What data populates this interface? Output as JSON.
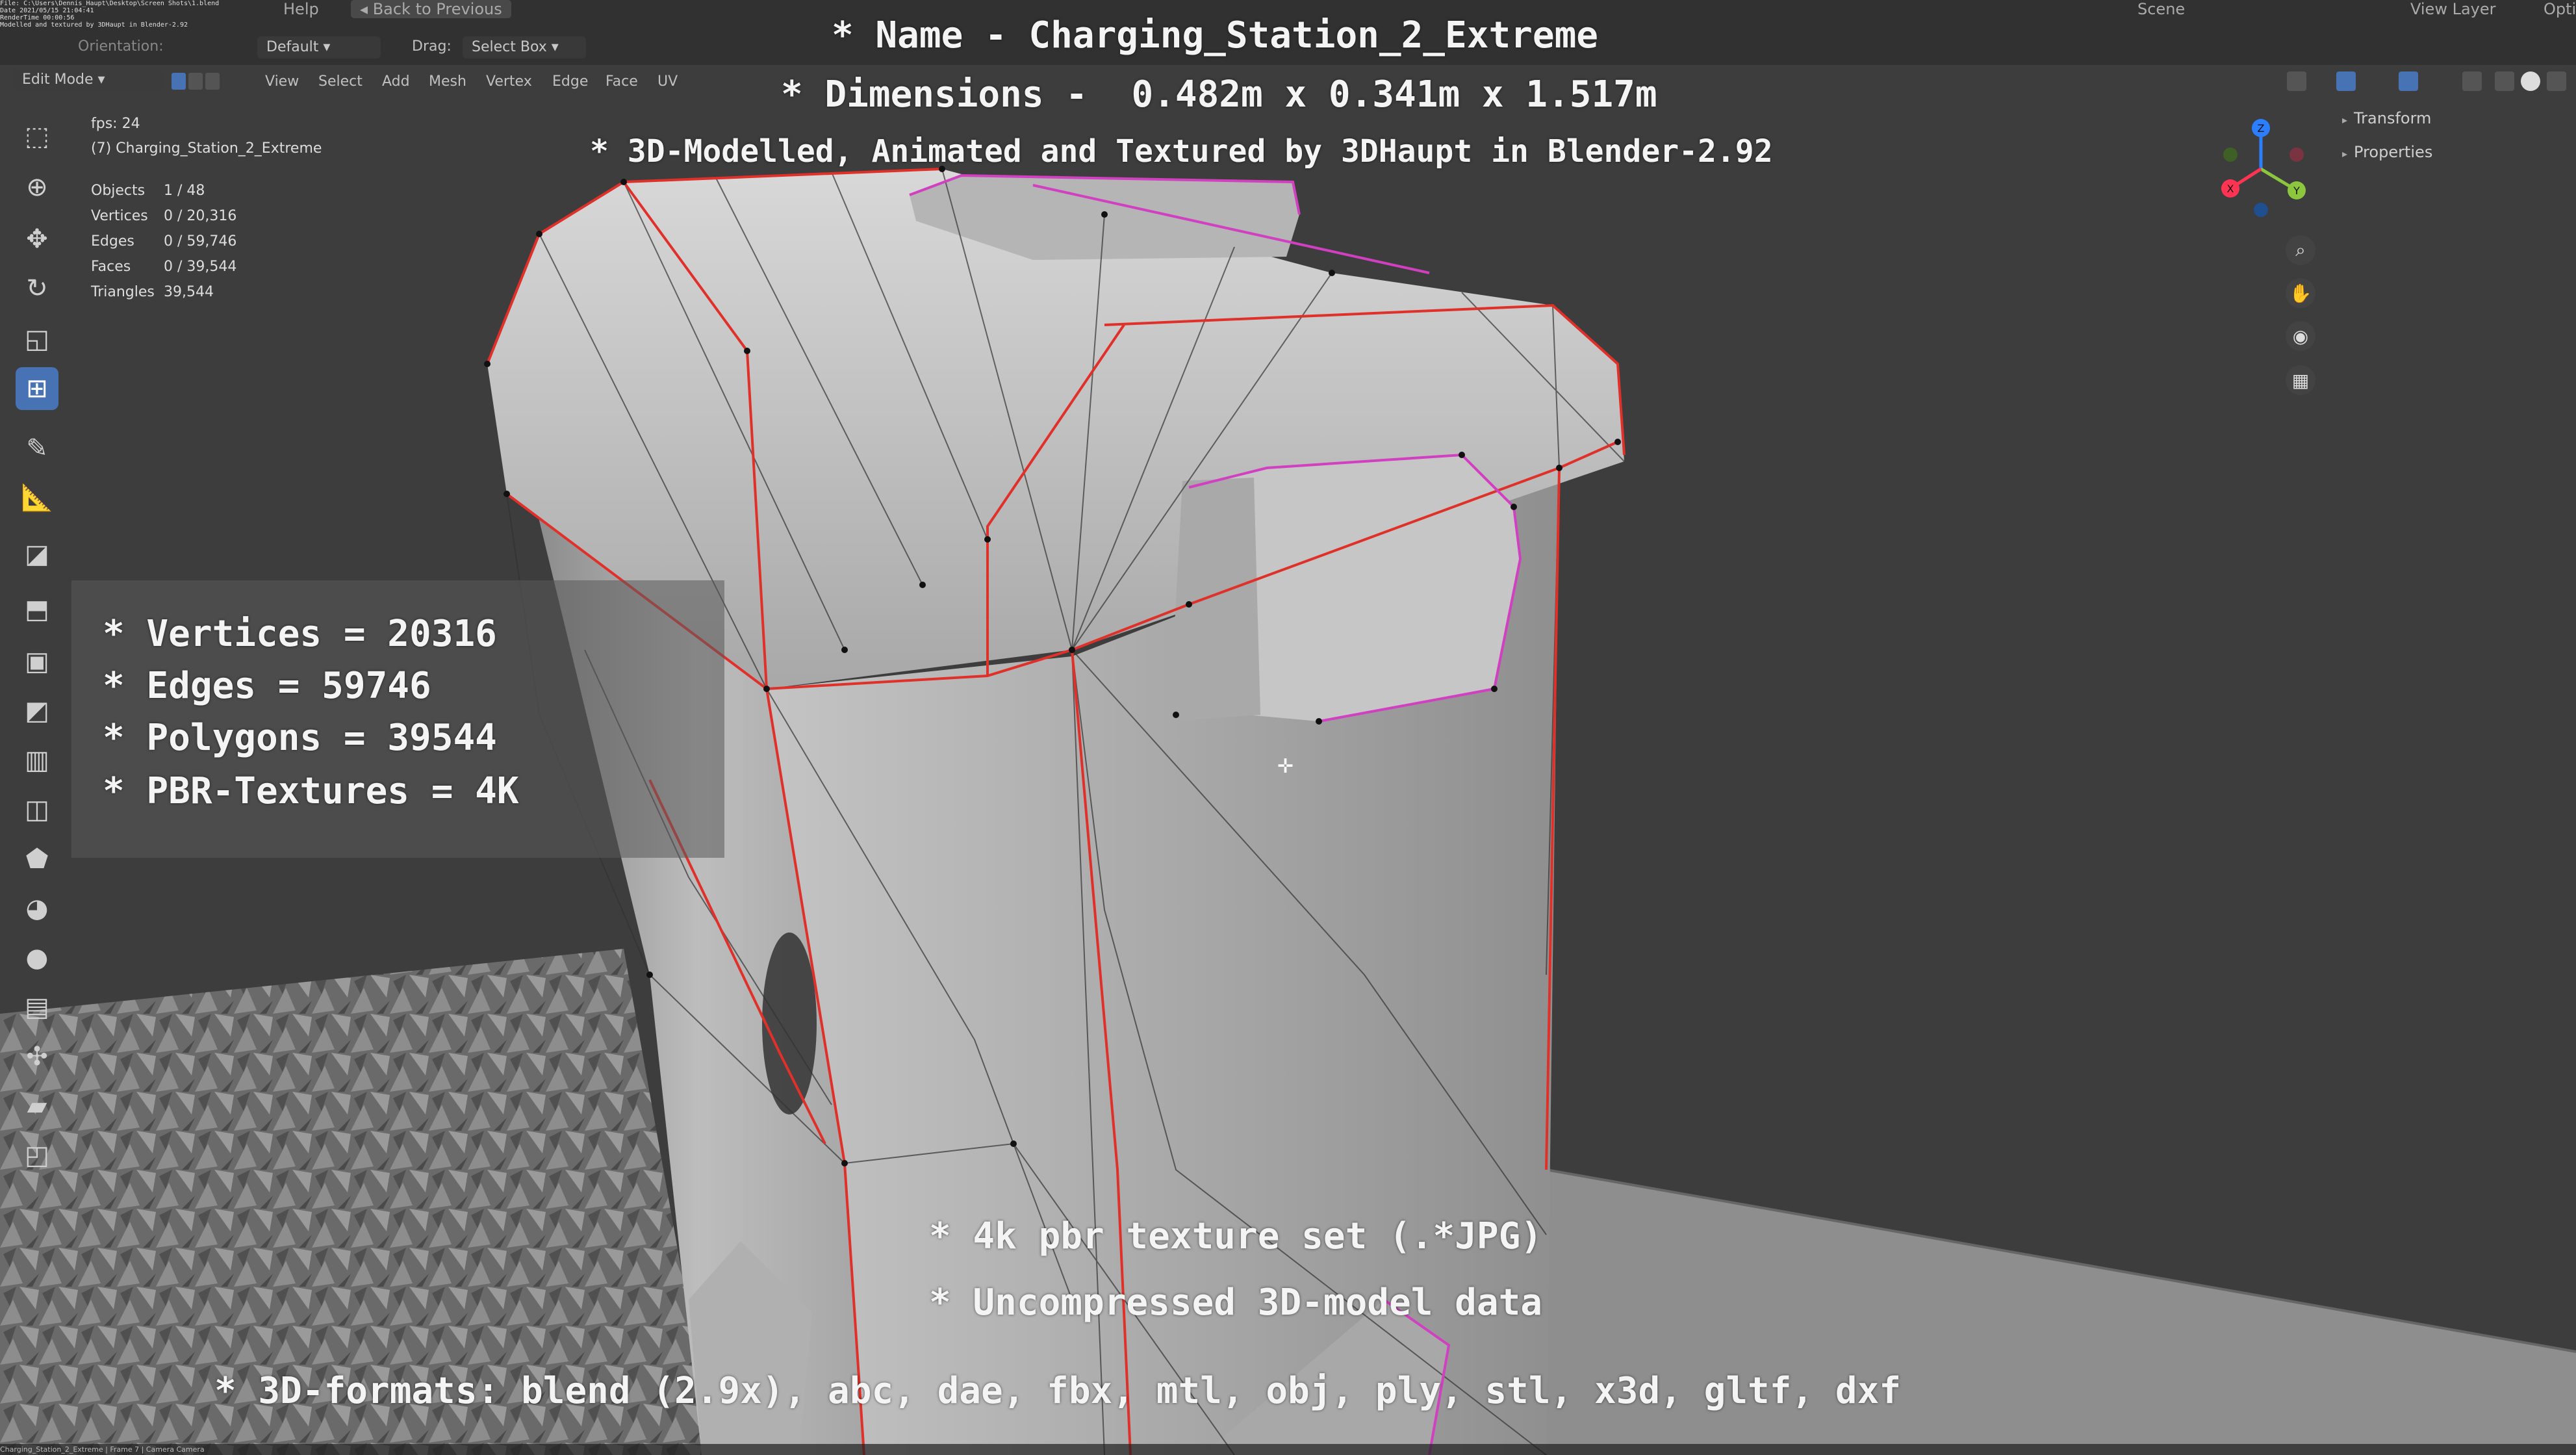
{
  "title_lines": {
    "name": "* Name - Charging_Station_2_Extreme",
    "dimensions": "* Dimensions -  0.482m x 0.341m x 1.517m",
    "credit": "* 3D-Modelled, Animated and Textured by 3DHaupt in Blender-2.92"
  },
  "stat_lines": {
    "vertices": "* Vertices = 20316",
    "edges": "* Edges = 59746",
    "polygons": "* Polygons = 39544",
    "textures": "* PBR-Textures = 4K"
  },
  "bottom_lines": {
    "texture_set": "* 4k pbr texture set (.*JPG)",
    "uncompressed": "* Uncompressed 3D-model data",
    "formats": "* 3D-formats: blend (2.9x), abc, dae, fbx, mtl, obj, ply, stl, x3d, gltf, dxf"
  },
  "top_menu": {
    "help": "Help",
    "back": "Back to Previous",
    "scene": "Scene",
    "view_layer": "View Layer",
    "opt": "Opti"
  },
  "info_text": "File: C:\\Users\\Dennis_Haupt\\Desktop\\Screen Shots\\1.blend\nDate 2021/05/15 21:04:41\nRenderTime 00:00:56\nModelled and textured by 3DHaupt in Blender-2.92",
  "header": {
    "orientation_label": "Orientation:",
    "orientation_value": "Default",
    "drag_label": "Drag:",
    "drag_value": "Select Box",
    "mode": "Edit Mode",
    "menus": [
      "View",
      "Select",
      "Add",
      "Mesh",
      "Vertex",
      "Edge",
      "Face",
      "UV"
    ]
  },
  "overlay": {
    "fps": "fps: 24",
    "object_name": "(7) Charging_Station_2_Extreme",
    "stats": [
      {
        "label": "Objects",
        "value": "1 / 48"
      },
      {
        "label": "Vertices",
        "value": "0 / 20,316"
      },
      {
        "label": "Edges",
        "value": "0 / 59,746"
      },
      {
        "label": "Faces",
        "value": "0 / 39,544"
      },
      {
        "label": "Triangles",
        "value": "39,544"
      }
    ]
  },
  "npanel": {
    "transform": "Transform",
    "properties": "Properties"
  },
  "gizmo_axes": {
    "x": "X",
    "y": "Y",
    "z": "Z"
  },
  "status_bar": "Charging_Station_2_Extreme | Frame 7 | Camera Camera",
  "colors": {
    "mesh_fill": "#b8b8b8",
    "seam_edge": "#e0302a",
    "selected_edge": "#d040c0",
    "accent_blue": "#4772b3",
    "background": "#3d3d3d"
  },
  "toolbar_icons": [
    "select-box-icon",
    "cursor-icon",
    "move-icon",
    "rotate-icon",
    "scale-icon",
    "transform-icon",
    "annotate-icon",
    "measure-icon",
    "add-cube-icon",
    "extrude-icon",
    "inset-icon",
    "bevel-icon",
    "loop-cut-icon",
    "knife-icon",
    "poly-build-icon",
    "spin-icon",
    "smooth-icon",
    "edge-slide-icon",
    "shrink-icon",
    "shear-icon",
    "rip-icon"
  ]
}
